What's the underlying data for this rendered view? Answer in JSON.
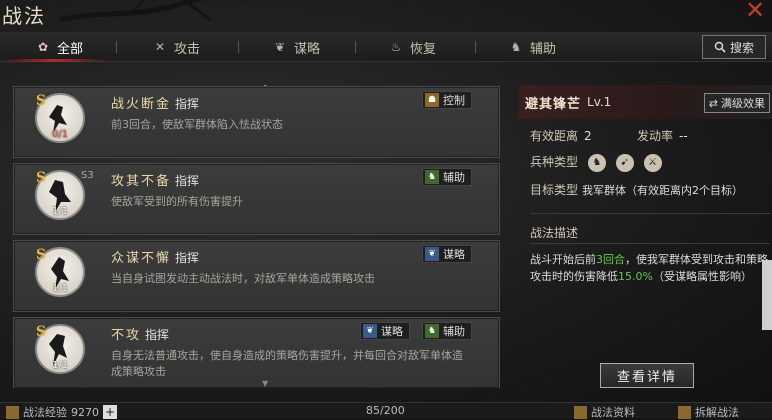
{
  "title": "战法",
  "tabs": [
    {
      "label": "全部",
      "icon": "all-icon",
      "active": true
    },
    {
      "label": "攻击",
      "icon": "crossed-swords-icon",
      "active": false
    },
    {
      "label": "谋略",
      "icon": "scroll-icon",
      "active": false
    },
    {
      "label": "恢复",
      "icon": "pot-icon",
      "active": false
    },
    {
      "label": "辅助",
      "icon": "horse-icon",
      "active": false
    }
  ],
  "search_label": "搜索",
  "cards": [
    {
      "grade": "S",
      "count": "0/1",
      "name": "战火断金",
      "role": "指挥",
      "desc": "前3回合，使敌军群体陷入怯战状态",
      "tags": [
        "控制"
      ]
    },
    {
      "grade": "S",
      "count": "1/1",
      "s3": "S3",
      "name": "攻其不备",
      "role": "指挥",
      "desc": "使敌军受到的所有伤害提升",
      "tags": [
        "辅助"
      ]
    },
    {
      "grade": "S",
      "count": "1/1",
      "name": "众谋不懈",
      "role": "指挥",
      "desc": "当自身试图发动主动战法时，对敌军单体造成策略攻击",
      "tags": [
        "谋略"
      ]
    },
    {
      "grade": "S",
      "count": "1/1",
      "name": "不攻",
      "role": "指挥",
      "desc": "自身无法普通攻击，使自身造成的策略伤害提升，并每回合对敌军单体造成策略攻击",
      "tags": [
        "谋略",
        "辅助"
      ]
    }
  ],
  "detail": {
    "name": "避其锋芒",
    "level": "Lv.1",
    "max_label": "满级效果",
    "range_label": "有效距离",
    "range_value": "2",
    "rate_label": "发动率",
    "rate_value": "--",
    "troop_label": "兵种类型",
    "target_label": "目标类型",
    "target_value": "我军群体（有效距离内2个目标）",
    "desc_title": "战法描述",
    "desc_parts": {
      "p1": "战斗开始后前",
      "hl1": "3回合",
      "p2": "，使我军群体受到攻击和策略攻击时的伤害降低",
      "hl2": "15.0%",
      "p3": "（受谋略属性影响）"
    },
    "detail_button": "查看详情"
  },
  "bottom": {
    "exp_label": "战法经验",
    "exp_value": "9270",
    "capacity": "85/200",
    "data_label": "战法资料",
    "decompose_label": "拆解战法"
  }
}
